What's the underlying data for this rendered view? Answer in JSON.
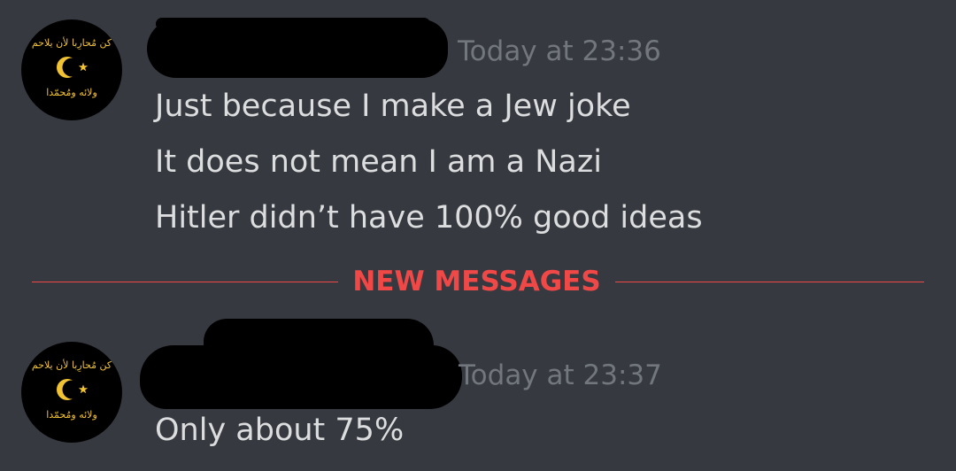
{
  "messages": [
    {
      "timestamp": "Today at 23:36",
      "lines": [
        "Just because I make a Jew joke",
        "It does not mean I am a Nazi",
        "Hitler didn’t have 100% good ideas"
      ]
    },
    {
      "timestamp": "Today at 23:37",
      "lines": [
        "Only about 75%"
      ]
    }
  ],
  "divider": {
    "label": "NEW MESSAGES"
  },
  "avatar": {
    "icon": "crescent-star-icon",
    "top_text": "كن مُحارِبا لأن يلاحم",
    "bottom_text": "ولائه ومُحمّدا"
  },
  "colors": {
    "background": "#36393f",
    "message_text": "#dcddde",
    "timestamp": "#72767d",
    "new_messages": "#f04747",
    "avatar_emblem": "#f1c232"
  }
}
